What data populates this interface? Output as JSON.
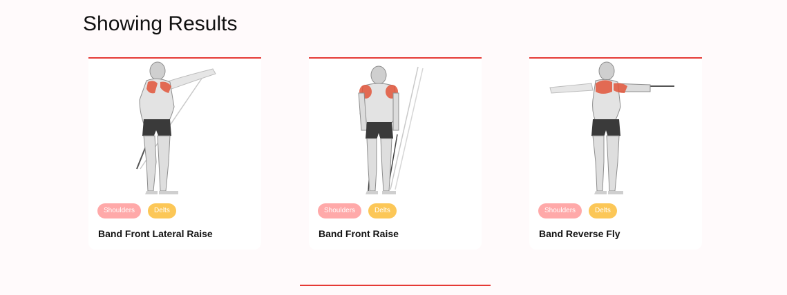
{
  "page": {
    "heading": "Showing Results"
  },
  "exercises": [
    {
      "name": "Band Front Lateral Raise",
      "bodyPart": "Shoulders",
      "target": "Delts",
      "image": "band-front-lateral-raise-illustration"
    },
    {
      "name": "Band Front Raise",
      "bodyPart": "Shoulders",
      "target": "Delts",
      "image": "band-front-raise-illustration"
    },
    {
      "name": "Band Reverse Fly",
      "bodyPart": "Shoulders",
      "target": "Delts",
      "image": "band-reverse-fly-illustration"
    }
  ],
  "colors": {
    "accent": "#e53935",
    "bodyPartTag": "#ffa9a9",
    "targetTag": "#fcc757",
    "highlightMuscle": "#e2553a"
  }
}
